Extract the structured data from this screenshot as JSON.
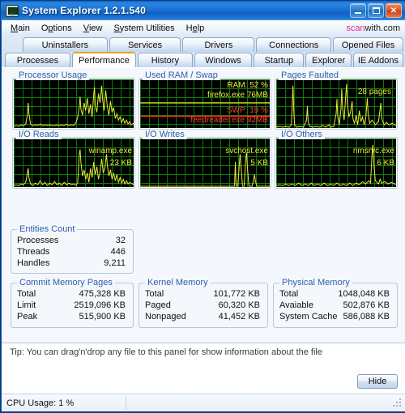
{
  "window": {
    "title": "System Explorer 1.2.1.540",
    "icon": "computer-monitor-icon",
    "buttons": {
      "minimize": "minimize-icon",
      "maximize": "maximize-icon",
      "close": "close-icon"
    }
  },
  "menu": {
    "items": [
      "Main",
      "Options",
      "View",
      "System Utilities",
      "Help"
    ],
    "brand_pink": "scan",
    "brand_dark": "with.com"
  },
  "tabs": {
    "row1": [
      "Uninstallers",
      "Services",
      "Drivers",
      "Connections",
      "Opened Files"
    ],
    "row2": [
      "Processes",
      "Performance",
      "History",
      "Windows",
      "Startup",
      "Explorer",
      "IE Addons"
    ],
    "selected": "Performance"
  },
  "graphs": [
    {
      "title": "Processor Usage",
      "labels": [],
      "accent": "#e9ec34"
    },
    {
      "title": "Used RAM / Swap",
      "labels": [
        {
          "text": "RAM: 52 %",
          "color": "yellow"
        },
        {
          "text": "firefox.exe 76MB",
          "color": "yellow"
        },
        {
          "text": "SWP: 19 %",
          "color": "red"
        },
        {
          "text": "feedreader.exe 92MB",
          "color": "red"
        }
      ],
      "accent": "#e9ec34"
    },
    {
      "title": "Pages Faulted",
      "labels": [
        {
          "text": "28 pages",
          "color": "yellow"
        }
      ],
      "accent": "#e9ec34"
    },
    {
      "title": "I/O Reads",
      "labels": [
        {
          "text": "winamp.exe",
          "color": "yellow"
        },
        {
          "text": "23 KB",
          "color": "yellow"
        }
      ],
      "accent": "#e9ec34"
    },
    {
      "title": "I/O Writes",
      "labels": [
        {
          "text": "svchost.exe",
          "color": "yellow"
        },
        {
          "text": "5 KB",
          "color": "yellow"
        }
      ],
      "accent": "#e9ec34"
    },
    {
      "title": "I/O Others",
      "labels": [
        {
          "text": "nmsrvc.exe",
          "color": "yellow"
        },
        {
          "text": "6 KB",
          "color": "yellow"
        }
      ],
      "accent": "#e9ec34"
    }
  ],
  "entities_count": {
    "caption": "Entities Count",
    "rows": [
      {
        "name": "Processes",
        "value": "32"
      },
      {
        "name": "Threads",
        "value": "446"
      },
      {
        "name": "Handles",
        "value": "9,211"
      }
    ]
  },
  "commit_memory": {
    "caption": "Commit Memory Pages",
    "rows": [
      {
        "name": "Total",
        "value": "475,328 KB"
      },
      {
        "name": "Limit",
        "value": "2519,096 KB"
      },
      {
        "name": "Peak",
        "value": "515,900 KB"
      }
    ]
  },
  "kernel_memory": {
    "caption": "Kernel Memory",
    "rows": [
      {
        "name": "Total",
        "value": "101,772 KB"
      },
      {
        "name": "Paged",
        "value": "60,320 KB"
      },
      {
        "name": "Nonpaged",
        "value": "41,452 KB"
      }
    ]
  },
  "physical_memory": {
    "caption": "Physical Memory",
    "rows": [
      {
        "name": "Total",
        "value": "1048,048 KB"
      },
      {
        "name": "Avaiable",
        "value": "502,876 KB"
      },
      {
        "name": "System Cache",
        "value": "586,088 KB"
      }
    ]
  },
  "tip": {
    "text": "Tip: You can drag'n'drop any file to this panel for show information about the file",
    "hide_label": "Hide"
  },
  "statusbar": {
    "cpu_usage": "CPU Usage: 1 %"
  },
  "colors": {
    "titlebar_blue": "#1c76d8",
    "graph_bg": "#000000",
    "graph_grid": "#0b7a0b",
    "series_yellow": "#e9ec34",
    "series_red": "#ff3b30",
    "caption_blue": "#2d5fa8",
    "accent_orange": "#f0a020",
    "brand_pink": "#e7258f"
  }
}
